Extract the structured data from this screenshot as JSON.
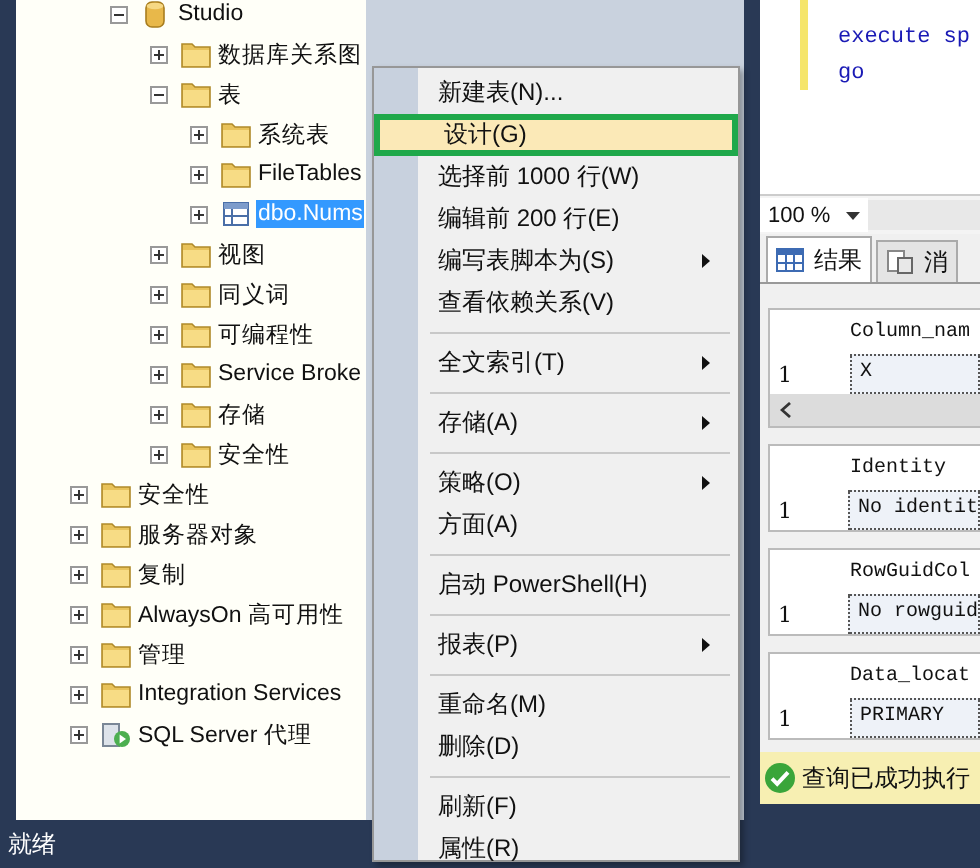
{
  "object_explorer": {
    "items": [
      {
        "children": [
          {
            "label": "Studio",
            "kind": "database",
            "expanded": true,
            "selected": false,
            "children": [
              {
                "label": "数据库关系图",
                "kind": "folder",
                "expanded": false,
                "selected": false
              },
              {
                "label": "表",
                "kind": "folder",
                "expanded": true,
                "selected": false,
                "children": [
                  {
                    "label": "系统表",
                    "kind": "folder",
                    "expanded": false,
                    "selected": false
                  },
                  {
                    "label": "FileTables",
                    "kind": "folder",
                    "expanded": false,
                    "selected": false
                  },
                  {
                    "label": "dbo.Nums",
                    "kind": "table",
                    "expanded": false,
                    "selected": true
                  }
                ]
              },
              {
                "label": "视图",
                "kind": "folder",
                "expanded": false,
                "selected": false
              },
              {
                "label": "同义词",
                "kind": "folder",
                "expanded": false,
                "selected": false
              },
              {
                "label": "可编程性",
                "kind": "folder",
                "expanded": false,
                "selected": false
              },
              {
                "label": "Service Broke",
                "kind": "folder",
                "expanded": false,
                "selected": false
              },
              {
                "label": "存储",
                "kind": "folder",
                "expanded": false,
                "selected": false
              },
              {
                "label": "安全性",
                "kind": "folder",
                "expanded": false,
                "selected": false
              }
            ]
          }
        ]
      },
      {
        "label": "安全性",
        "kind": "folder",
        "expanded": false,
        "selected": false
      },
      {
        "label": "服务器对象",
        "kind": "folder",
        "expanded": false,
        "selected": false
      },
      {
        "label": "复制",
        "kind": "folder",
        "expanded": false,
        "selected": false
      },
      {
        "label": "AlwaysOn 高可用性",
        "kind": "folder",
        "expanded": false,
        "selected": false
      },
      {
        "label": "管理",
        "kind": "folder",
        "expanded": false,
        "selected": false
      },
      {
        "label": "Integration Services",
        "kind": "folder",
        "expanded": false,
        "selected": false
      },
      {
        "label": "SQL Server 代理",
        "kind": "agent",
        "expanded": false,
        "selected": false
      }
    ]
  },
  "context_menu": {
    "groups": [
      [
        {
          "label": "新建表(N)...",
          "submenu": false,
          "selected": false
        },
        {
          "label": "设计(G)",
          "submenu": false,
          "selected": true
        },
        {
          "label": "选择前 1000 行(W)",
          "submenu": false,
          "selected": false
        },
        {
          "label": "编辑前 200 行(E)",
          "submenu": false,
          "selected": false
        },
        {
          "label": "编写表脚本为(S)",
          "submenu": true,
          "selected": false
        },
        {
          "label": "查看依赖关系(V)",
          "submenu": false,
          "selected": false
        }
      ],
      [
        {
          "label": "全文索引(T)",
          "submenu": true,
          "selected": false
        }
      ],
      [
        {
          "label": "存储(A)",
          "submenu": true,
          "selected": false
        }
      ],
      [
        {
          "label": "策略(O)",
          "submenu": true,
          "selected": false
        },
        {
          "label": "方面(A)",
          "submenu": false,
          "selected": false
        }
      ],
      [
        {
          "label": "启动 PowerShell(H)",
          "submenu": false,
          "selected": false
        }
      ],
      [
        {
          "label": "报表(P)",
          "submenu": true,
          "selected": false
        }
      ],
      [
        {
          "label": "重命名(M)",
          "submenu": false,
          "selected": false
        },
        {
          "label": "删除(D)",
          "submenu": false,
          "selected": false
        }
      ],
      [
        {
          "label": "刷新(F)",
          "submenu": false,
          "selected": false
        },
        {
          "label": "属性(R)",
          "submenu": false,
          "selected": false
        }
      ]
    ]
  },
  "query_editor": {
    "lines": [
      "execute sp",
      "go"
    ],
    "zoom": "100 %"
  },
  "results": {
    "tabs": [
      {
        "label": "结果",
        "kind": "grid",
        "selected": true
      },
      {
        "label": "消",
        "kind": "messages",
        "selected": false
      }
    ],
    "grids": [
      {
        "header": "Column_nam",
        "rows": [
          {
            "number": "1",
            "value": "X"
          }
        ],
        "scrollbar": true
      },
      {
        "header": "Identity",
        "rows": [
          {
            "number": "1",
            "value": "No identit"
          }
        ],
        "scrollbar": false
      },
      {
        "header": "RowGuidCol",
        "rows": [
          {
            "number": "1",
            "value": "No rowguid"
          }
        ],
        "scrollbar": false
      },
      {
        "header": "Data_locat",
        "rows": [
          {
            "number": "1",
            "value": "PRIMARY"
          }
        ],
        "scrollbar": false
      }
    ],
    "message": "查询已成功执行"
  },
  "status_bar": {
    "text": "就绪"
  }
}
